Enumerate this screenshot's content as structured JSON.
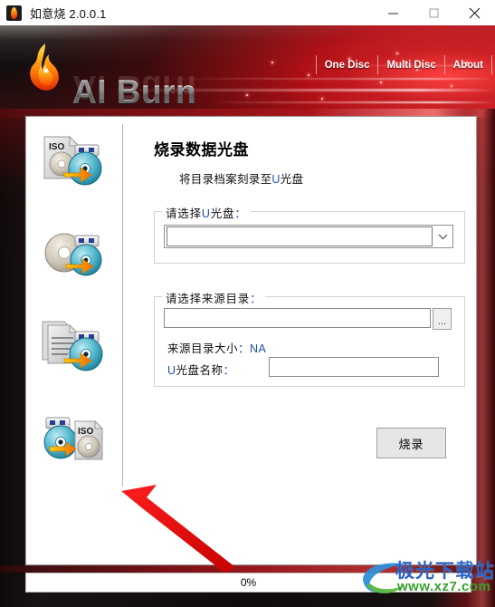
{
  "window": {
    "title": "如意烧 2.0.0.1",
    "app_icon": "flame-icon",
    "minimize_label": "—",
    "maximize_label": "□",
    "close_label": "✕"
  },
  "banner": {
    "logo_text": "AI Burn",
    "logo_icon": "flame-logo-icon",
    "accent_color": "#c8141c"
  },
  "nav": {
    "tabs": [
      {
        "label": "One Disc"
      },
      {
        "label": "Multi Disc"
      },
      {
        "label": "About"
      }
    ]
  },
  "sidebar": {
    "items": [
      {
        "icon": "iso-to-disc-icon",
        "name": "burn-iso-to-disc"
      },
      {
        "icon": "disc-to-disc-icon",
        "name": "copy-disc"
      },
      {
        "icon": "files-to-disc-icon",
        "name": "burn-data-disc"
      },
      {
        "icon": "disc-to-iso-icon",
        "name": "create-iso-from-disc"
      }
    ]
  },
  "content": {
    "title": "烧录数据光盘",
    "subtitle_pre": "将目录档案刻录至",
    "subtitle_u": "U",
    "subtitle_post": "光盘",
    "disc_group": {
      "legend_pre": "请选择",
      "legend_u": "U",
      "legend_post": "光盘",
      "legend_colon": "：",
      "combo_value": "",
      "combo_placeholder": ""
    },
    "source_group": {
      "legend": "请选择来源目录",
      "legend_colon": "：",
      "path_value": "",
      "path_placeholder": "",
      "browse_label": "...",
      "size_label": "来源目录大小",
      "size_colon": "：",
      "size_value": "NA",
      "name_label_pre": "",
      "name_label_u": "U",
      "name_label_post": "光盘名称",
      "name_colon": "：",
      "name_value": "",
      "name_placeholder": ""
    },
    "burn_button": "烧录"
  },
  "status": {
    "progress_text": "0%",
    "progress_percent": 0
  },
  "watermark": {
    "site_cn": "极光下载站",
    "site_url": "www.xz7.com"
  }
}
